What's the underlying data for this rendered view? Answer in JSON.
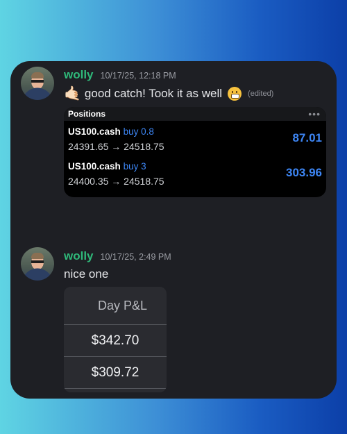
{
  "message1": {
    "username": "wolly",
    "timestamp": "10/17/25, 12:18 PM",
    "text": "good catch! Took it as well",
    "hand_emoji": "🤙🏻",
    "edited": "(edited)",
    "icons": [
      "call-me-hand-emoji",
      "grimacing-face-emoji"
    ]
  },
  "positions": {
    "title": "Positions",
    "menu_icon": "more-dots-icon",
    "rows": [
      {
        "symbol": "US100.cash",
        "side": "buy 0.8",
        "prices": "24391.65 → 24518.75",
        "pl": "87.01"
      },
      {
        "symbol": "US100.cash",
        "side": "buy 3",
        "prices": "24400.35 → 24518.75",
        "pl": "303.96"
      }
    ]
  },
  "message2": {
    "username": "wolly",
    "timestamp": "10/17/25, 2:49 PM",
    "text": "nice one"
  },
  "day_pl": {
    "header": "Day P&L",
    "values": [
      "$342.70",
      "$309.72"
    ]
  },
  "colors": {
    "username": "#2fb97a",
    "pl_blue": "#3d86f5",
    "card_bg": "#1e1f24"
  }
}
